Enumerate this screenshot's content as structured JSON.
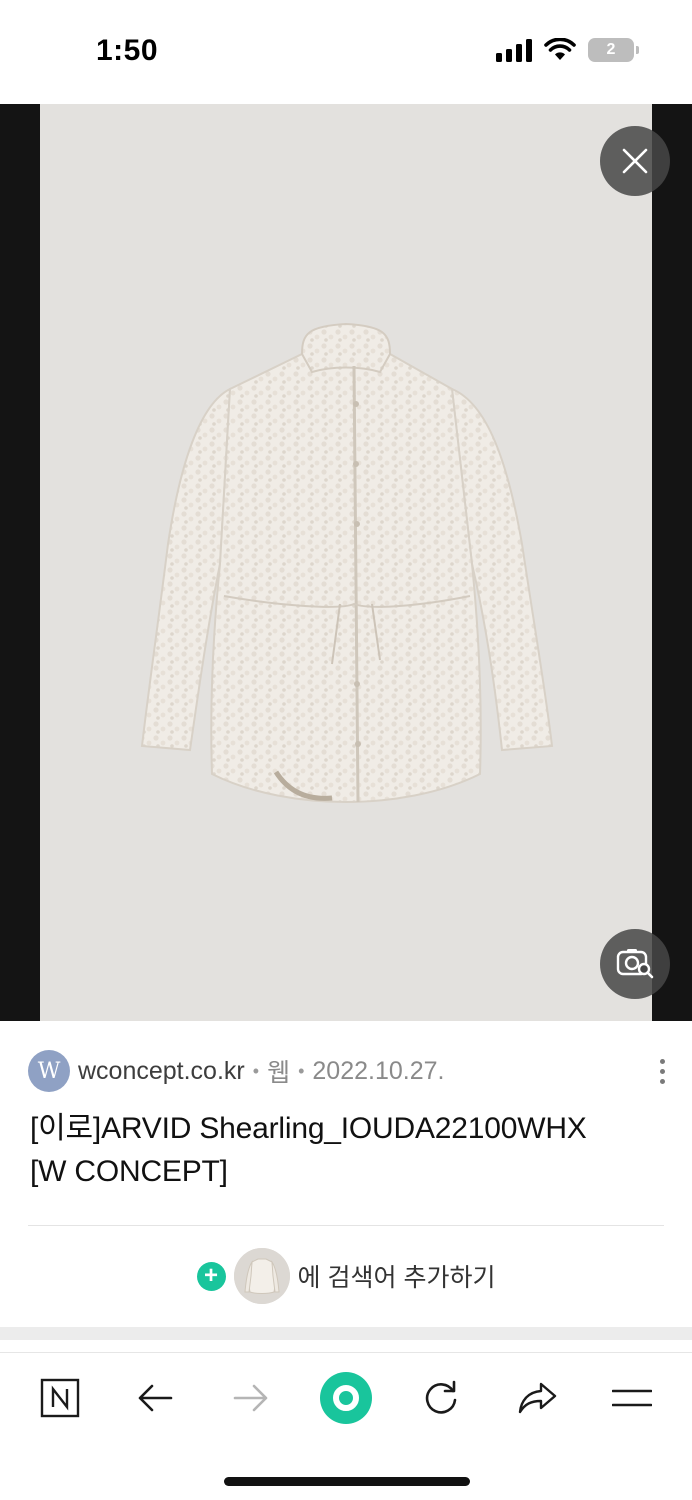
{
  "status_bar": {
    "time": "1:50",
    "battery_label": "2"
  },
  "viewer": {
    "icons": {
      "close": "close-icon",
      "lens": "image-search-icon"
    }
  },
  "result": {
    "favicon_letter": "W",
    "domain": "wconcept.co.kr",
    "category": "웹",
    "date": "2022.10.27.",
    "title_line1": "[이로]ARVID Shearling_IOUDA22100WHX",
    "title_line2": "[W CONCEPT]",
    "add_label": "에 검색어 추가하기"
  },
  "toolbar": {
    "items": [
      "naver-home-icon",
      "back-arrow-icon",
      "forward-arrow-icon",
      "green-dot-icon",
      "refresh-icon",
      "share-icon",
      "menu-icon"
    ]
  },
  "colors": {
    "accent_green": "#19c59c",
    "viewer_bg": "#141414",
    "photo_bg": "#e3e1de"
  }
}
